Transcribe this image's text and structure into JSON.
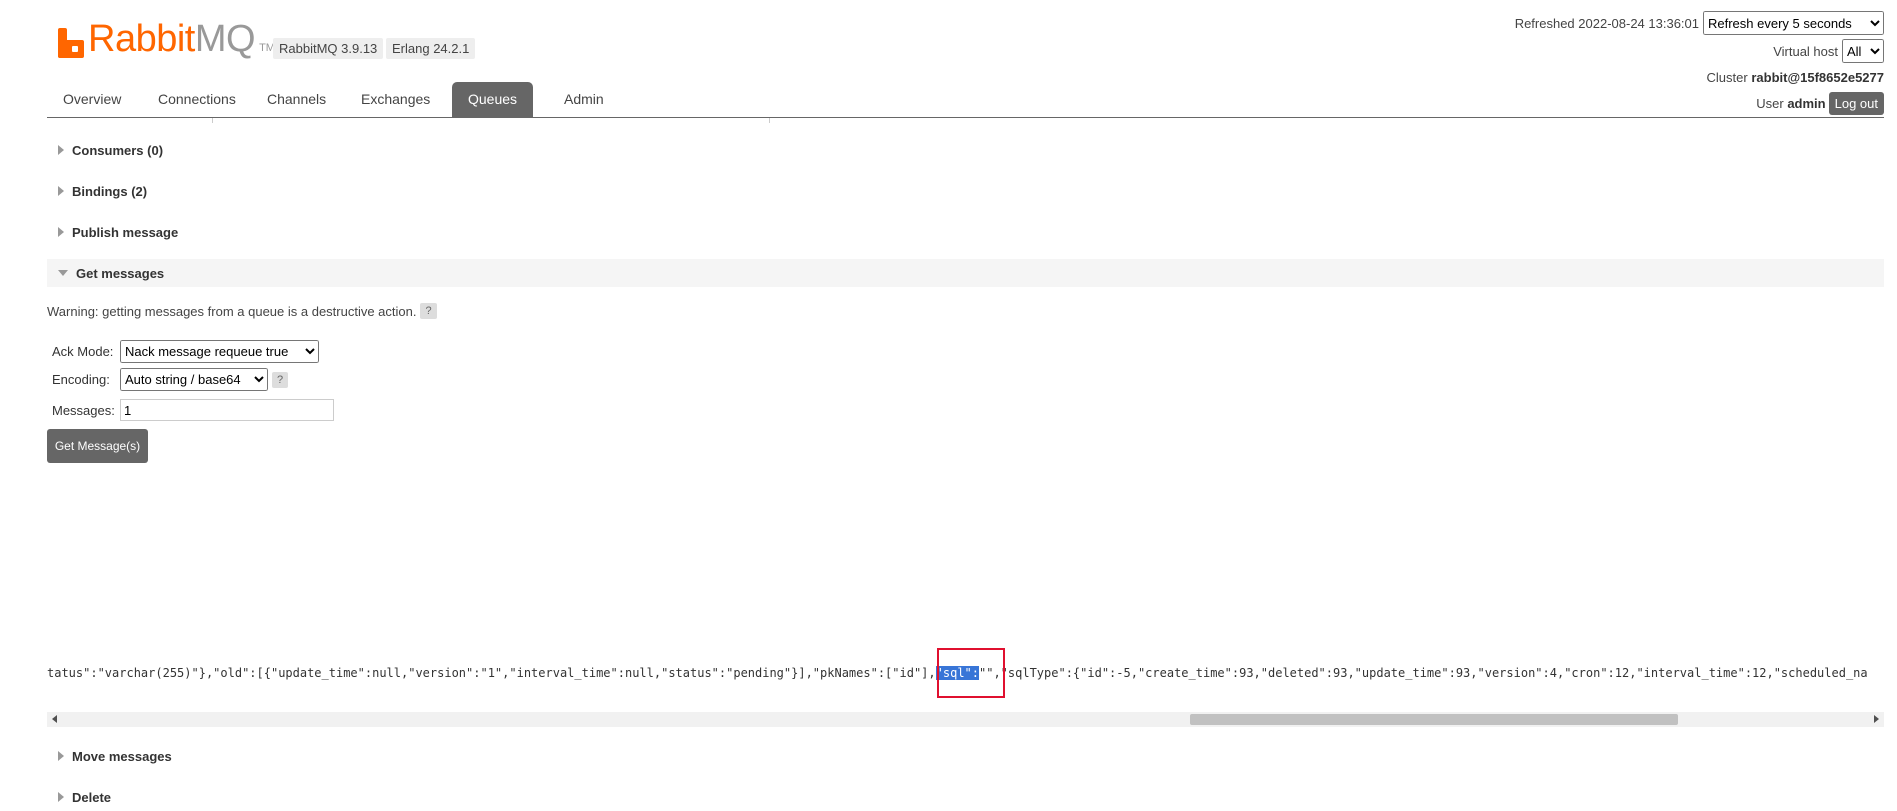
{
  "header": {
    "logo_rabbit": "Rabbit",
    "logo_mq": "MQ",
    "logo_tm": "TM",
    "version_badge": "RabbitMQ 3.9.13",
    "erlang_badge": "Erlang 24.2.1",
    "refreshed_label": "Refreshed 2022-08-24 13:36:01",
    "refresh_select": "Refresh every 5 seconds",
    "vhost_label": "Virtual host",
    "vhost_select": "All",
    "cluster_label": "Cluster",
    "cluster_name": "rabbit@15f8652e5277",
    "user_label": "User",
    "user_name": "admin",
    "logout_label": "Log out"
  },
  "tabs": [
    {
      "label": "Overview"
    },
    {
      "label": "Connections"
    },
    {
      "label": "Channels"
    },
    {
      "label": "Exchanges"
    },
    {
      "label": "Queues"
    },
    {
      "label": "Admin"
    }
  ],
  "active_tab": "Queues",
  "sections": {
    "consumers": "Consumers (0)",
    "bindings": "Bindings (2)",
    "publish": "Publish message",
    "get": "Get messages",
    "move": "Move messages",
    "delete": "Delete"
  },
  "get_messages": {
    "warning": "Warning: getting messages from a queue is a destructive action.",
    "help": "?",
    "ack_label": "Ack Mode:",
    "ack_value": "Nack message requeue true",
    "encoding_label": "Encoding:",
    "encoding_value": "Auto string / base64",
    "messages_label": "Messages:",
    "messages_value": "1",
    "button_label": "Get Message(s)"
  },
  "payload": {
    "before": "tatus\":\"varchar(255)\"},\"old\":[{\"update_time\":null,\"version\":\"1\",\"interval_time\":null,\"status\":\"pending\"}],\"pkNames\":[\"id\"],",
    "highlight_key": "\"sql\":",
    "highlight_value": "\"\"",
    "after": ",\"sqlType\":{\"id\":-5,\"create_time\":93,\"deleted\":93,\"update_time\":93,\"version\":4,\"cron\":12,\"interval_time\":12,\"scheduled_na"
  },
  "colors": {
    "accent": "#666666",
    "brand": "#ff6600",
    "highlight": "#3875d7",
    "annotation": "#e0102f"
  }
}
